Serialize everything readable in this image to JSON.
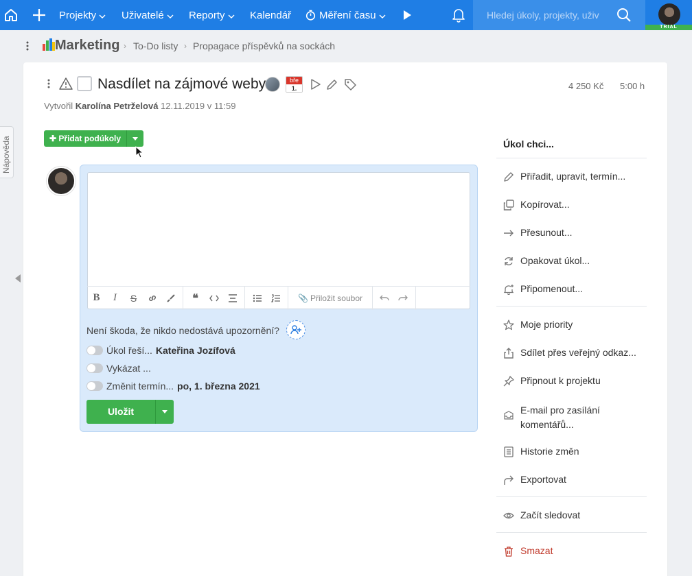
{
  "topbar": {
    "nav": [
      "Projekty",
      "Uživatelé",
      "Reporty",
      "Kalendář",
      "Měření času"
    ],
    "search_placeholder": "Hledej úkoly, projekty, uživ",
    "trial_badge": "TRIAL"
  },
  "breadcrumb": {
    "project": "Marketing",
    "items": [
      "To-Do listy",
      "Propagace příspěvků na sockách"
    ]
  },
  "help_tab": "Nápověda",
  "task": {
    "title": "Nasdílet na zájmové weby",
    "due_month": "bře",
    "due_day": "1.",
    "price": "4 250 Kč",
    "hours": "5:00 h",
    "created_prefix": "Vytvořil",
    "created_by": "Karolína Petrželová",
    "created_at": "12.11.2019 v 11:59"
  },
  "add_subtasks_label": "Přidat podúkoly",
  "editor": {
    "attach_label": "Přiložit soubor"
  },
  "notify_text": "Není škoda, že nikdo nedostává upozornění?",
  "toggles": [
    {
      "label": "Úkol řeší...",
      "value": "Kateřina Jozífová"
    },
    {
      "label": "Vykázat ...",
      "value": ""
    },
    {
      "label": "Změnit termín...",
      "value": "po, 1. března 2021"
    }
  ],
  "save_label": "Uložit",
  "side": {
    "title": "Úkol chci...",
    "items": [
      "Přiřadit, upravit, termín...",
      "Kopírovat...",
      "Přesunout...",
      "Opakovat úkol...",
      "Připomenout...",
      "Moje priority",
      "Sdílet přes veřejný odkaz...",
      "Připnout k projektu",
      "E-mail pro zasílání komentářů...",
      "Historie změn",
      "Exportovat",
      "Začít sledovat",
      "Smazat"
    ]
  },
  "colors": {
    "topbar": "#1f7ee5",
    "green": "#3fb14e",
    "danger": "#c0392b"
  }
}
